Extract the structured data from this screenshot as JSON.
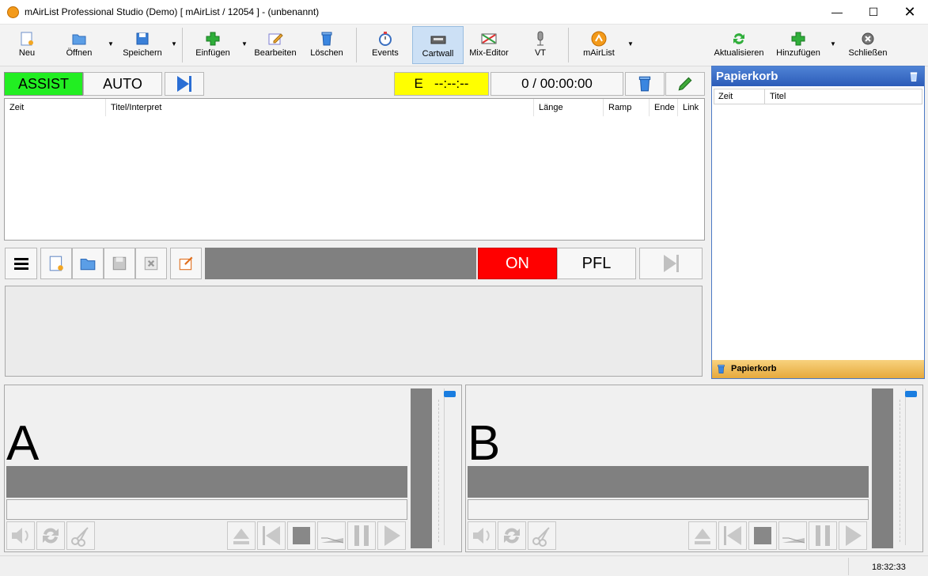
{
  "window": {
    "title": "mAirList Professional Studio (Demo) [ mAirList / 12054 ] - (unbenannt)"
  },
  "toolbar": {
    "new": "Neu",
    "open": "Öffnen",
    "save": "Speichern",
    "insert": "Einfügen",
    "edit": "Bearbeiten",
    "delete": "Löschen",
    "events": "Events",
    "cartwall": "Cartwall",
    "mix_editor": "Mix-Editor",
    "vt": "VT",
    "mairlist": "mAirList",
    "refresh": "Aktualisieren",
    "add": "Hinzufügen",
    "close": "Schließen"
  },
  "playlist_header": {
    "assist": "ASSIST",
    "auto": "AUTO",
    "timer": "E   --:--:--",
    "counter": "0 / 00:00:00"
  },
  "playlist": {
    "columns": [
      "Zeit",
      "Titel/Interpret",
      "Länge",
      "Ramp",
      "Ende",
      "Link"
    ]
  },
  "cart": {
    "on": "ON",
    "pfl": "PFL"
  },
  "bin": {
    "title": "Papierkorb",
    "columns": [
      "Zeit",
      "Titel"
    ],
    "tab": "Papierkorb"
  },
  "players": [
    {
      "letter": "A"
    },
    {
      "letter": "B"
    }
  ],
  "status": {
    "clock": "18:32:33"
  },
  "colors": {
    "assist_green": "#22ee22",
    "on_red": "#ff0000",
    "timer_yellow": "#ffff00",
    "accent_blue": "#2c5cb8"
  }
}
